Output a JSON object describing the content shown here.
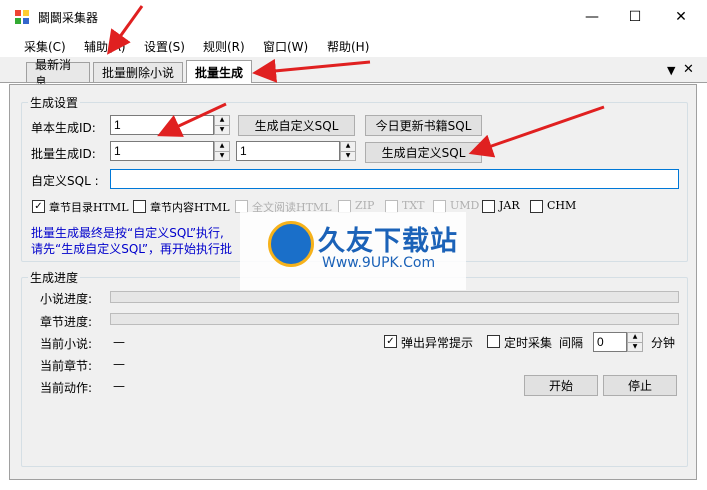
{
  "window": {
    "title": "鬬鬬采集器",
    "minimize": "—",
    "maximize": "☐",
    "close": "✕"
  },
  "menu": [
    "采集(C)",
    "辅助(A)",
    "设置(S)",
    "规则(R)",
    "窗口(W)",
    "帮助(H)"
  ],
  "tabs": [
    "最新消息",
    "批量删除小说",
    "批量生成"
  ],
  "tab_controls": {
    "dropdown": "▼",
    "close": "✕"
  },
  "gen": {
    "group_title": "生成设置",
    "single_label": "单本生成ID:",
    "single_value": "1",
    "btn_custom_sql": "生成自定义SQL",
    "btn_today_sql": "今日更新书籍SQL",
    "batch_label": "批量生成ID:",
    "batch_from": "1",
    "batch_to": "1",
    "btn_custom_sql2": "生成自定义SQL",
    "custom_sql_label": "自定义SQL :",
    "custom_sql_value": "",
    "checks": [
      {
        "label": "章节目录HTML",
        "checked": true,
        "disabled": false
      },
      {
        "label": "章节内容HTML",
        "checked": false,
        "disabled": false
      },
      {
        "label": "全文阅读HTML",
        "checked": false,
        "disabled": true
      },
      {
        "label": "ZIP",
        "checked": false,
        "disabled": true
      },
      {
        "label": "TXT",
        "checked": false,
        "disabled": true
      },
      {
        "label": "UMD",
        "checked": false,
        "disabled": true
      },
      {
        "label": "JAR",
        "checked": false,
        "disabled": false
      },
      {
        "label": "CHM",
        "checked": false,
        "disabled": false
      }
    ],
    "note1": "批量生成最终是按“自定义SQL”执行,",
    "note2": "请先“生成自定义SQL”，再开始执行批"
  },
  "progress": {
    "group_title": "生成进度",
    "novel_label": "小说进度:",
    "novel_progress": 0,
    "chapter_label": "章节进度:",
    "chapter_progress": 0,
    "cur_novel_label": "当前小说:",
    "cur_novel_value": "—",
    "cur_chapter_label": "当前章节:",
    "cur_chapter_value": "—",
    "cur_action_label": "当前动作:",
    "cur_action_value": "—",
    "popup_label": "弹出异常提示",
    "popup_checked": true,
    "timer_label": "定时采集",
    "timer_checked": false,
    "interval_label": "间隔",
    "interval_value": "0",
    "minutes_label": "分钟",
    "start_btn": "开始",
    "stop_btn": "停止"
  },
  "watermark": {
    "text": "久友下载站",
    "url": "Www.9UPK.Com"
  },
  "colors": {
    "arrow": "#e02020",
    "note": "#0000cc",
    "panel_bg": "#f0f0f0"
  }
}
